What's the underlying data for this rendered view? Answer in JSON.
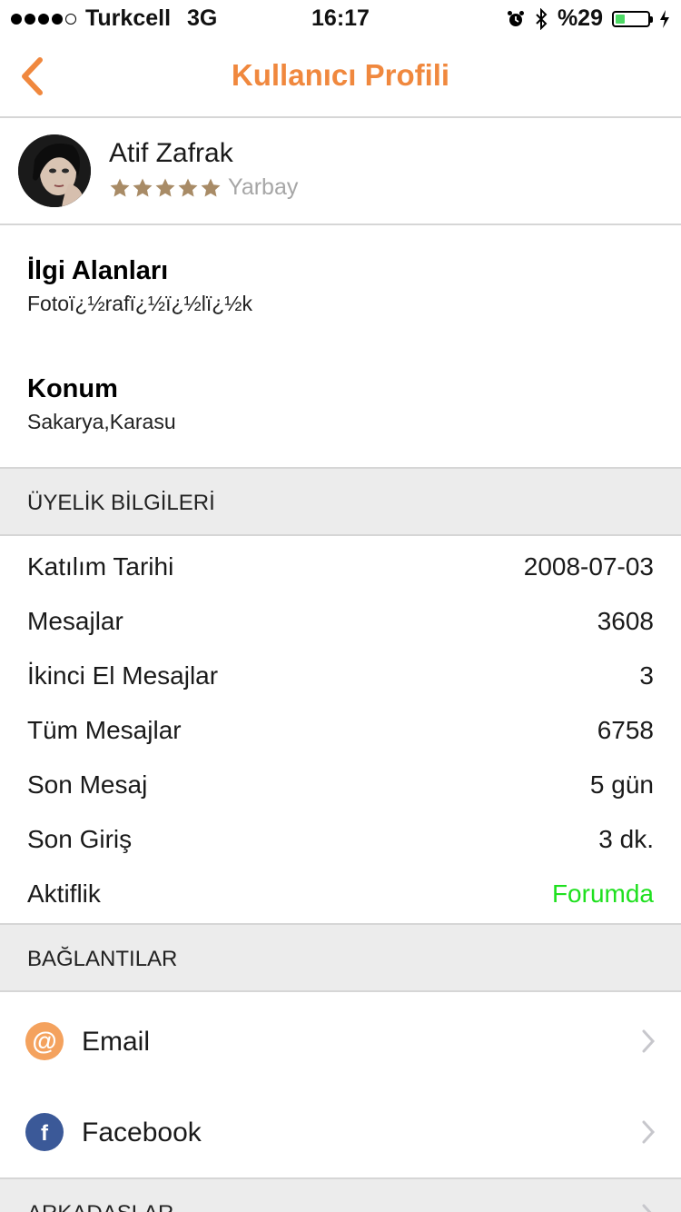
{
  "status_bar": {
    "carrier": "Turkcell",
    "network": "3G",
    "time": "16:17",
    "battery_text": "%29",
    "battery_level": 0.29,
    "battery_color": "#4cd964",
    "icons": [
      "signal-dots",
      "alarm-icon",
      "bluetooth-icon",
      "battery-icon",
      "charging-icon"
    ]
  },
  "nav": {
    "title": "Kullanıcı Profili",
    "accent_color": "#f0883e",
    "back_icon": "chevron-left-icon"
  },
  "profile": {
    "name": "Atif Zafrak",
    "rank": "Yarbay",
    "stars": 5,
    "star_color": "#a88b66"
  },
  "interests": {
    "title": "İlgi Alanları",
    "value": "Fotoï¿½rafï¿½ï¿½lï¿½k"
  },
  "location": {
    "title": "Konum",
    "value": "Sakarya,Karasu"
  },
  "membership": {
    "header": "ÜYELİK BİLGİLERİ",
    "rows": [
      {
        "label": "Katılım Tarihi",
        "value": "2008-07-03"
      },
      {
        "label": "Mesajlar",
        "value": "3608"
      },
      {
        "label": "İkinci El Mesajlar",
        "value": "3"
      },
      {
        "label": "Tüm Mesajlar",
        "value": "6758"
      },
      {
        "label": "Son Mesaj",
        "value": "5 gün"
      },
      {
        "label": "Son Giriş",
        "value": "3 dk."
      },
      {
        "label": "Aktiflik",
        "value": "Forumda",
        "value_color": "#1ee01e"
      }
    ]
  },
  "links": {
    "header": "BAĞLANTILAR",
    "items": [
      {
        "label": "Email",
        "icon": "at-sign-icon",
        "icon_color": "#f4a25e"
      },
      {
        "label": "Facebook",
        "icon": "facebook-icon",
        "icon_color": "#3b5998"
      }
    ]
  },
  "friends": {
    "header": "ARKADAŞLAR"
  }
}
